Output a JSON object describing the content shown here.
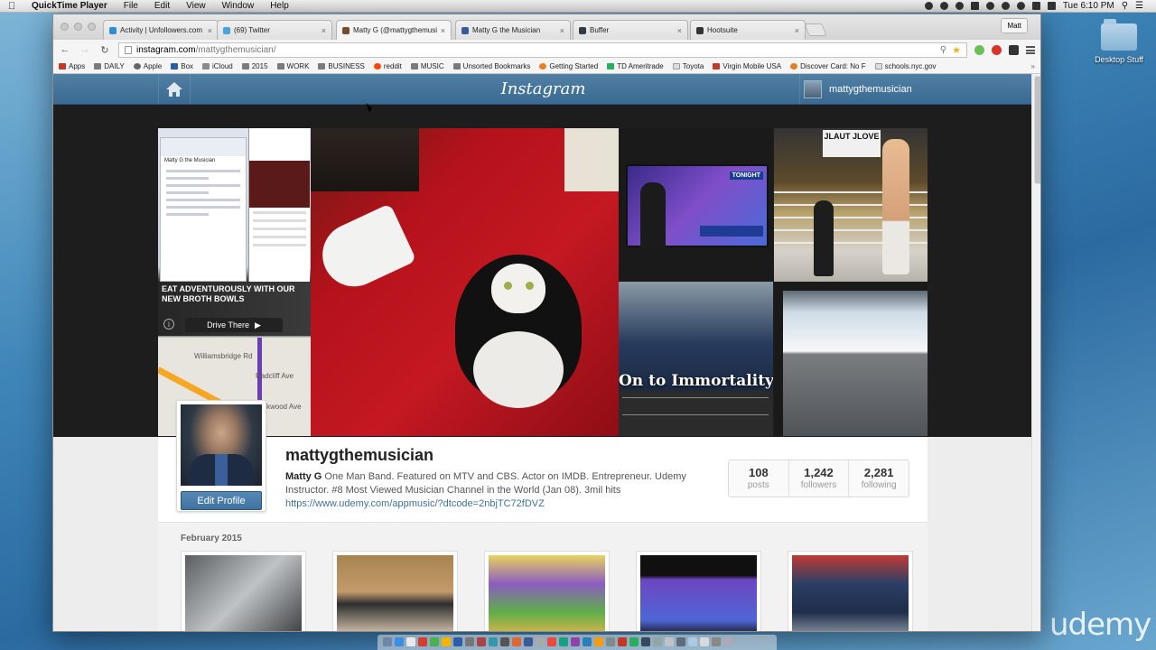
{
  "menubar": {
    "app_name": "QuickTime Player",
    "items": [
      "File",
      "Edit",
      "View",
      "Window",
      "Help"
    ],
    "clock": "Tue 6:10 PM"
  },
  "desktop": {
    "folder_label": "Desktop Stuff",
    "watermark": "udemy"
  },
  "browser": {
    "profile_button": "Matt",
    "tabs": [
      {
        "label": "Activity | Unfollowers.com",
        "color": "#2f8fd6"
      },
      {
        "label": "(69) Twitter",
        "color": "#4aa3df"
      },
      {
        "label": "Matty G (@mattygthemusi",
        "color": "#7a4a2a"
      },
      {
        "label": "Matty G the Musician",
        "color": "#3b5998"
      },
      {
        "label": "Buffer",
        "color": "#323b43"
      },
      {
        "label": "Hootsuite",
        "color": "#333333"
      }
    ],
    "url_host": "instagram.com",
    "url_path": "/mattygthemusician/",
    "bookmarks": [
      {
        "label": "Apps",
        "icon": "apps-icon"
      },
      {
        "label": "DAILY",
        "icon": "folder-icon"
      },
      {
        "label": "Apple",
        "icon": "apple-icon"
      },
      {
        "label": "Box",
        "icon": "box-icon"
      },
      {
        "label": "iCloud",
        "icon": "icloud-icon"
      },
      {
        "label": "2015",
        "icon": "folder-icon"
      },
      {
        "label": "WORK",
        "icon": "folder-icon"
      },
      {
        "label": "BUSINESS",
        "icon": "folder-icon"
      },
      {
        "label": "reddit",
        "icon": "reddit-icon"
      },
      {
        "label": "MUSIC",
        "icon": "folder-icon"
      },
      {
        "label": "Unsorted Bookmarks",
        "icon": "folder-icon"
      },
      {
        "label": "Getting Started",
        "icon": "firefox-icon"
      },
      {
        "label": "TD Ameritrade",
        "icon": "td-icon"
      },
      {
        "label": "Toyota",
        "icon": "page-icon"
      },
      {
        "label": "Virgin Mobile USA",
        "icon": "virgin-icon"
      },
      {
        "label": "Discover Card: No F",
        "icon": "discover-icon"
      },
      {
        "label": "schools.nyc.gov",
        "icon": "page-icon"
      }
    ],
    "bookmarks_more": "»"
  },
  "instagram": {
    "logo": "Instagram",
    "header_username": "mattygthemusician",
    "cover": {
      "ad_text": "EAT ADVENTUROUSLY WITH OUR NEW BROTH BOWLS",
      "ad_button": "Drive There",
      "map_street1": "Williamsbridge Rd",
      "map_street2": "Radcliff Ave",
      "map_street3": "kwood Ave",
      "phone_profile_name": "Matty G the Musician",
      "tv_label": "TONIGHT",
      "sign_text": "JLAUT JLOVE",
      "football_headline": "On to Immortality"
    },
    "profile": {
      "username": "mattygthemusician",
      "bio_name": "Matty G",
      "bio_text": "One Man Band. Featured on MTV and CBS. Actor on IMDB. Entrepreneur. Udemy Instructor. #8 Most Viewed Musician Channel in the World (Jan 08). 3mil hits",
      "link": "https://www.udemy.com/appmusic/?dtcode=2nbjTC72fDVZ",
      "edit_button": "Edit Profile",
      "stats": [
        {
          "num": "108",
          "label": "posts"
        },
        {
          "num": "1,242",
          "label": "followers"
        },
        {
          "num": "2,281",
          "label": "following"
        }
      ]
    },
    "grid": {
      "month": "February 2015"
    }
  }
}
